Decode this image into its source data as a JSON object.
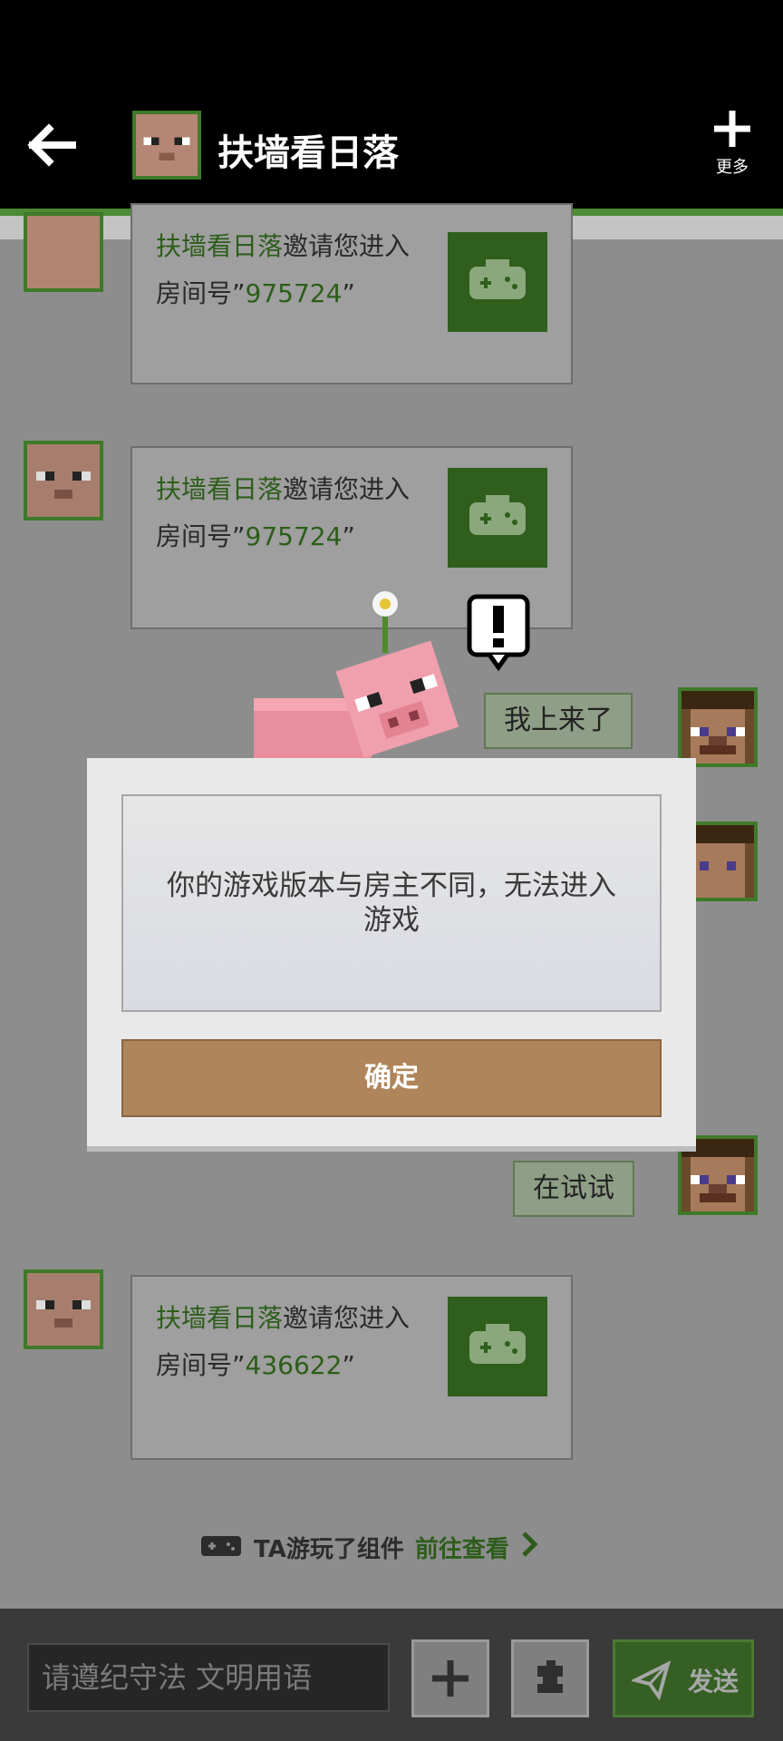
{
  "header": {
    "title": "扶墙看日落",
    "more_label": "更多"
  },
  "messages": [
    {
      "type": "invite",
      "name": "扶墙看日落",
      "text": "邀请您进入",
      "room_label": "房间号”",
      "room_number": "975724",
      "room_close": "”"
    },
    {
      "type": "invite",
      "name": "扶墙看日落",
      "text": "邀请您进入",
      "room_label": "房间号”",
      "room_number": "975724",
      "room_close": "”"
    },
    {
      "type": "self",
      "text": "我上来了"
    },
    {
      "type": "self",
      "text": "在试试"
    },
    {
      "type": "invite",
      "name": "扶墙看日落",
      "text": "邀请您进入",
      "room_label": "房间号”",
      "room_number": "436622",
      "room_close": "”"
    }
  ],
  "ta_played": {
    "text": "TA游玩了组件",
    "link": "前往查看"
  },
  "composer": {
    "placeholder": "请遵纪守法 文明用语",
    "send_label": "发送"
  },
  "dialog": {
    "message": "你的游戏版本与房主不同，无法进入游戏",
    "ok_label": "确定"
  },
  "colors": {
    "accent_green": "#2f5e1d",
    "ok_button": "#b0855b"
  }
}
